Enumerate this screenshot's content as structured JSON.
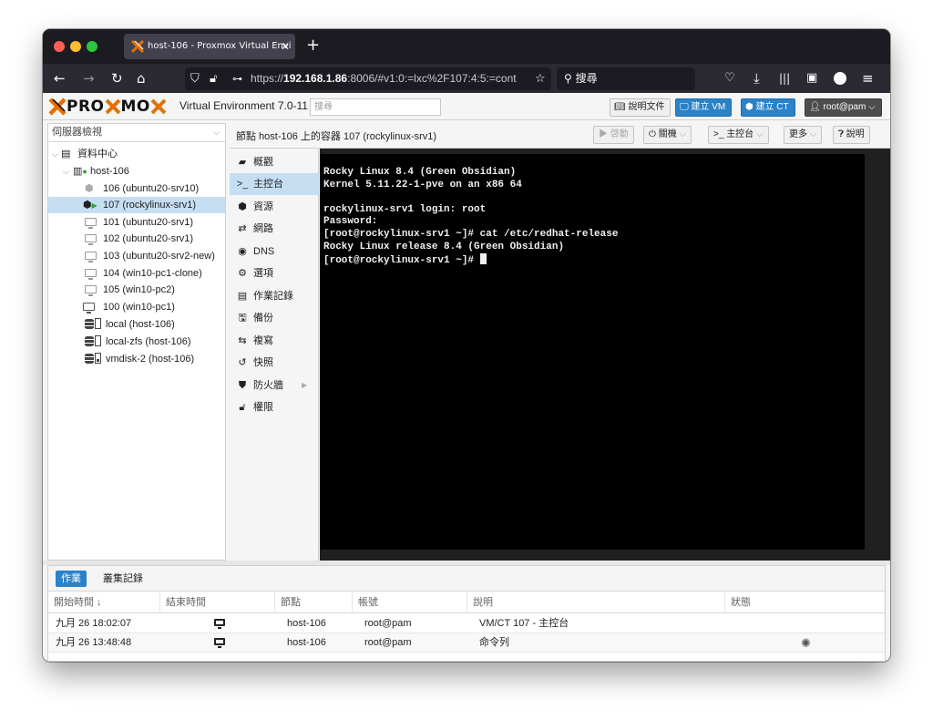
{
  "browser": {
    "tab_title": "host-106 - Proxmox Virtual Envi",
    "tab_close": "✕",
    "new_tab": "+",
    "url_host": "192.168.1.86",
    "url_prefix": "https://",
    "url_rest": ":8006/#v1:0:=lxc%2F107:4:5:=cont",
    "search_placeholder": "搜尋"
  },
  "header": {
    "logo_text_1": "PRO",
    "logo_text_2": "MO",
    "version": "Virtual Environment 7.0-11",
    "search_placeholder": "搜尋",
    "docs_button": "說明文件",
    "create_vm_button": "建立 VM",
    "create_ct_button": "建立 CT",
    "user_button": "root@pam"
  },
  "tree": {
    "view_selector": "伺服器檢視",
    "items": [
      {
        "label": "資料中心"
      },
      {
        "label": "host-106"
      },
      {
        "label": "106 (ubuntu20-srv10)"
      },
      {
        "label": "107 (rockylinux-srv1)"
      },
      {
        "label": "101 (ubuntu20-srv1)"
      },
      {
        "label": "102 (ubuntu20-srv1)"
      },
      {
        "label": "103 (ubuntu20-srv2-new)"
      },
      {
        "label": "104 (win10-pc1-clone)"
      },
      {
        "label": "105 (win10-pc2)"
      },
      {
        "label": "100 (win10-pc1)"
      },
      {
        "label": "local (host-106)"
      },
      {
        "label": "local-zfs (host-106)"
      },
      {
        "label": "vmdisk-2 (host-106)"
      }
    ]
  },
  "content_header": {
    "breadcrumb": "節點 host-106 上的容器 107 (rockylinux-srv1)",
    "start_button": "啓動",
    "shutdown_button": "關機",
    "console_button": "主控台",
    "more_button": "更多",
    "help_button": "說明"
  },
  "menu": {
    "items": [
      {
        "label": "概觀"
      },
      {
        "label": "主控台"
      },
      {
        "label": "資源"
      },
      {
        "label": "網路"
      },
      {
        "label": "DNS"
      },
      {
        "label": "選項"
      },
      {
        "label": "作業記錄"
      },
      {
        "label": "備份"
      },
      {
        "label": "複寫"
      },
      {
        "label": "快照"
      },
      {
        "label": "防火牆"
      },
      {
        "label": "權限"
      }
    ]
  },
  "terminal": {
    "lines": [
      "Rocky Linux 8.4 (Green Obsidian)",
      "Kernel 5.11.22-1-pve on an x86 64",
      "",
      "rockylinux-srv1 login: root",
      "Password:",
      "[root@rockylinux-srv1 ~]# cat /etc/redhat-release",
      "Rocky Linux release 8.4 (Green Obsidian)",
      "[root@rockylinux-srv1 ~]# "
    ]
  },
  "tasks": {
    "tabs": [
      "作業",
      "叢集記錄"
    ],
    "columns": [
      "開始時間 ↓",
      "結束時間",
      "節點",
      "帳號",
      "說明",
      "狀態"
    ],
    "rows": [
      {
        "start": "九月 26 18:02:07",
        "node": "host-106",
        "user": "root@pam",
        "desc": "VM/CT 107 - 主控台"
      },
      {
        "start": "九月 26 13:48:48",
        "node": "host-106",
        "user": "root@pam",
        "desc": "命令列"
      }
    ]
  }
}
